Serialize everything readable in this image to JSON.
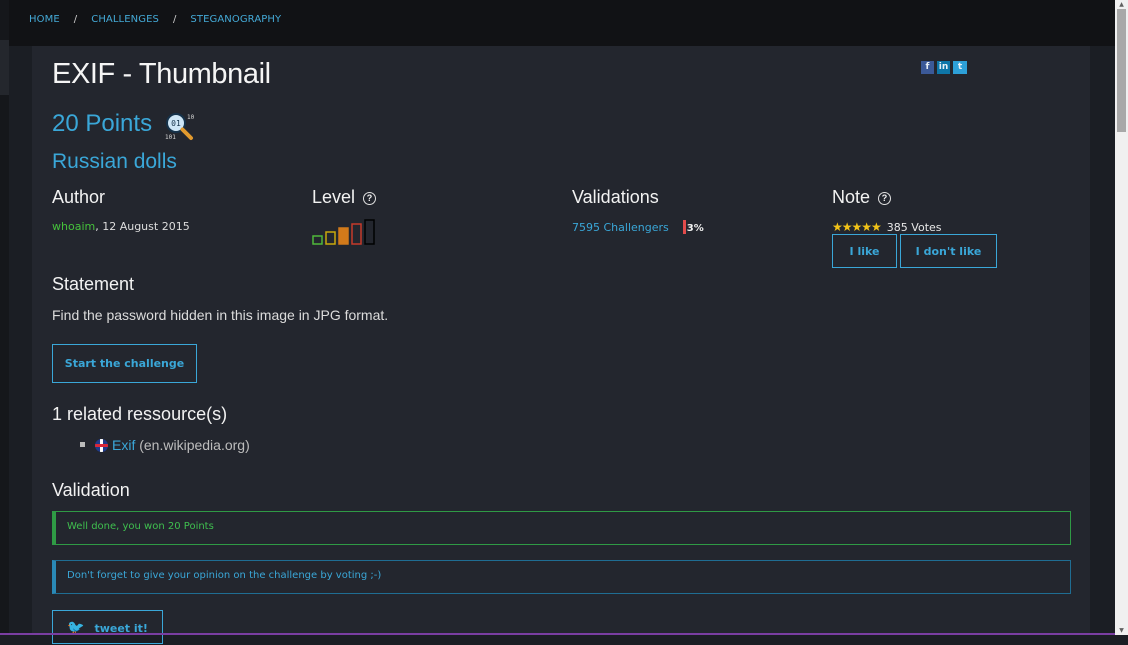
{
  "breadcrumb": [
    "HOME",
    "CHALLENGES",
    "STEGANOGRAPHY"
  ],
  "challenge": {
    "title": "EXIF - Thumbnail",
    "points": "20 Points",
    "category": "Russian dolls"
  },
  "author": {
    "heading": "Author",
    "name": "whoaim",
    "date": ",  12 August 2015"
  },
  "level": {
    "heading": "Level",
    "value": 3,
    "max": 5
  },
  "validations": {
    "heading": "Validations",
    "challengers": "7595 Challengers",
    "percent": "3%"
  },
  "note": {
    "heading": "Note",
    "stars": 5,
    "votes": "385 Votes",
    "like_label": "I like",
    "dislike_label": "I don't like"
  },
  "statement": {
    "heading": "Statement",
    "text": "Find the password hidden in this image in JPG format.",
    "start_label": "Start the challenge"
  },
  "resources": {
    "heading": "1 related ressource(s)",
    "items": [
      {
        "label": "Exif",
        "source": "(en.wikipedia.org)"
      }
    ]
  },
  "validation": {
    "heading": "Validation",
    "success": "Well done, you won 20 Points",
    "info": "Don't forget to give your opinion on the challenge by voting ;-)",
    "tweet_label": "tweet it!"
  },
  "colors": {
    "accent": "#3aa7d8",
    "success": "#3fbf4f",
    "danger": "#e24b4b",
    "background": "#1b1e24",
    "panel": "#23262e"
  },
  "icons": [
    "facebook-icon",
    "linkedin-icon",
    "twitter-icon",
    "search-binary-icon",
    "help-icon",
    "star-icon",
    "uk-flag-icon",
    "twitter-bird-icon"
  ]
}
